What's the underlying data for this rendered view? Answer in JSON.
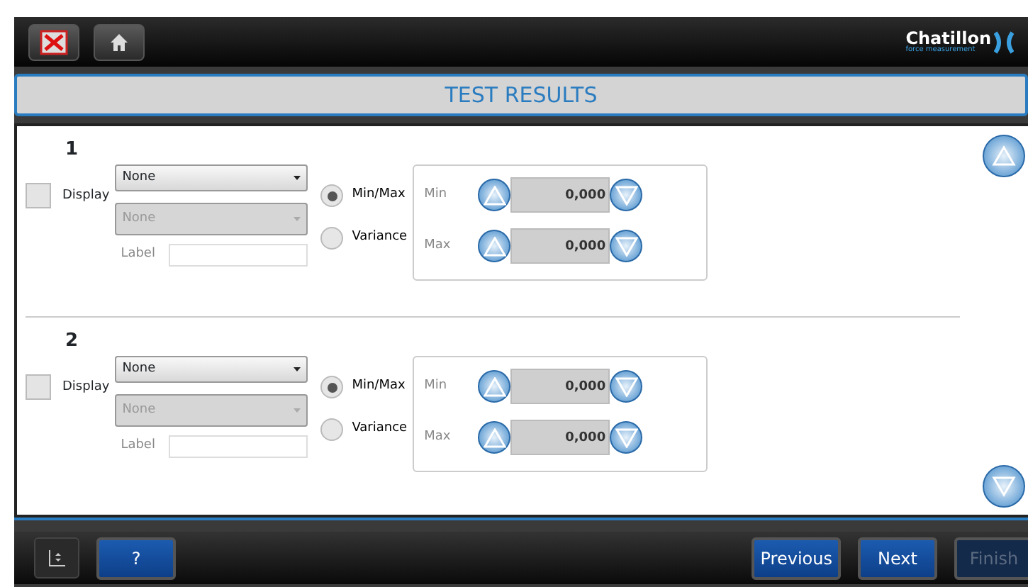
{
  "logo": {
    "name": "Chatillon",
    "tagline": "force measurement"
  },
  "title": "TEST RESULTS",
  "sections": [
    {
      "number": "1",
      "display": {
        "label": "Display",
        "checked": false
      },
      "selects": [
        {
          "value": "None",
          "disabled": false
        },
        {
          "value": "None",
          "disabled": true
        }
      ],
      "label_field": {
        "label": "Label"
      },
      "options": [
        {
          "label": "Min/Max",
          "selected": true
        },
        {
          "label": "Variance",
          "selected": false
        }
      ],
      "limits": [
        {
          "label": "Min",
          "value": "0,000"
        },
        {
          "label": "Max",
          "value": "0,000"
        }
      ]
    },
    {
      "number": "2",
      "display": {
        "label": "Display",
        "checked": false
      },
      "selects": [
        {
          "value": "None",
          "disabled": false
        },
        {
          "value": "None",
          "disabled": true
        }
      ],
      "label_field": {
        "label": "Label"
      },
      "options": [
        {
          "label": "Min/Max",
          "selected": true
        },
        {
          "label": "Variance",
          "selected": false
        }
      ],
      "limits": [
        {
          "label": "Min",
          "value": "0,000"
        },
        {
          "label": "Max",
          "value": "0,000"
        }
      ]
    }
  ],
  "footer": {
    "help": {
      "label": "?"
    },
    "nav": [
      {
        "label": "Previous",
        "disabled": false
      },
      {
        "label": "Next",
        "disabled": false
      },
      {
        "label": "Finish",
        "disabled": true
      }
    ]
  }
}
